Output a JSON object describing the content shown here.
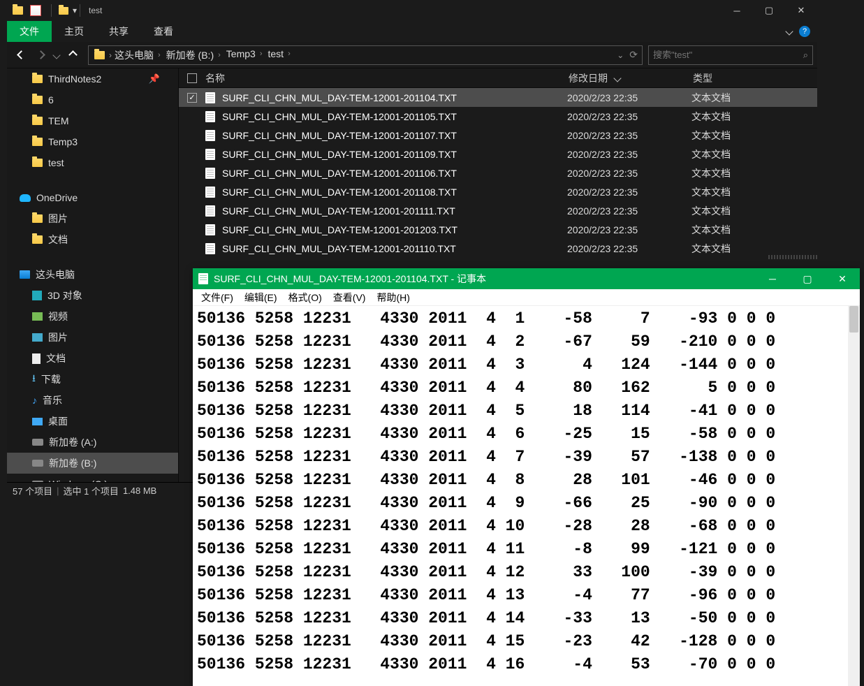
{
  "explorer": {
    "window_title": "test",
    "ribbon_tabs": [
      "文件",
      "主页",
      "共享",
      "查看"
    ],
    "breadcrumbs": [
      "这头电脑",
      "新加卷 (B:)",
      "Temp3",
      "test"
    ],
    "search_placeholder": "搜索\"test\"",
    "nav_pane": {
      "quick": [
        {
          "label": "ThirdNotes2",
          "pinned": true
        },
        {
          "label": "6"
        },
        {
          "label": "TEM"
        },
        {
          "label": "Temp3"
        },
        {
          "label": "test"
        }
      ],
      "onedrive_label": "OneDrive",
      "onedrive_children": [
        {
          "label": "图片"
        },
        {
          "label": "文档"
        }
      ],
      "thispc_label": "这头电脑",
      "thispc_children": [
        {
          "label": "3D 对象",
          "ic": "cube"
        },
        {
          "label": "视频",
          "ic": "film"
        },
        {
          "label": "图片",
          "ic": "pic"
        },
        {
          "label": "文档",
          "ic": "doc"
        },
        {
          "label": "下载",
          "ic": "down"
        },
        {
          "label": "音乐",
          "ic": "music"
        },
        {
          "label": "桌面",
          "ic": "desk"
        },
        {
          "label": "新加卷 (A:)",
          "ic": "drive"
        },
        {
          "label": "新加卷 (B:)",
          "ic": "drive",
          "selected": true
        },
        {
          "label": "Windows (C:)",
          "ic": "drive"
        }
      ]
    },
    "columns": {
      "name": "名称",
      "date": "修改日期",
      "type": "类型"
    },
    "files": [
      {
        "name": "SURF_CLI_CHN_MUL_DAY-TEM-12001-201104.TXT",
        "date": "2020/2/23 22:35",
        "type": "文本文档",
        "selected": true
      },
      {
        "name": "SURF_CLI_CHN_MUL_DAY-TEM-12001-201105.TXT",
        "date": "2020/2/23 22:35",
        "type": "文本文档"
      },
      {
        "name": "SURF_CLI_CHN_MUL_DAY-TEM-12001-201107.TXT",
        "date": "2020/2/23 22:35",
        "type": "文本文档"
      },
      {
        "name": "SURF_CLI_CHN_MUL_DAY-TEM-12001-201109.TXT",
        "date": "2020/2/23 22:35",
        "type": "文本文档"
      },
      {
        "name": "SURF_CLI_CHN_MUL_DAY-TEM-12001-201106.TXT",
        "date": "2020/2/23 22:35",
        "type": "文本文档"
      },
      {
        "name": "SURF_CLI_CHN_MUL_DAY-TEM-12001-201108.TXT",
        "date": "2020/2/23 22:35",
        "type": "文本文档"
      },
      {
        "name": "SURF_CLI_CHN_MUL_DAY-TEM-12001-201111.TXT",
        "date": "2020/2/23 22:35",
        "type": "文本文档"
      },
      {
        "name": "SURF_CLI_CHN_MUL_DAY-TEM-12001-201203.TXT",
        "date": "2020/2/23 22:35",
        "type": "文本文档"
      },
      {
        "name": "SURF_CLI_CHN_MUL_DAY-TEM-12001-201110.TXT",
        "date": "2020/2/23 22:35",
        "type": "文本文档"
      }
    ],
    "status": {
      "count": "57 个项目",
      "sel": "选中 1 个项目",
      "size": "1.48 MB"
    }
  },
  "notepad": {
    "title": "SURF_CLI_CHN_MUL_DAY-TEM-12001-201104.TXT - 记事本",
    "menu": [
      "文件(F)",
      "编辑(E)",
      "格式(O)",
      "查看(V)",
      "帮助(H)"
    ],
    "lines": [
      "50136 5258 12231   4330 2011  4  1    -58     7    -93 0 0 0",
      "50136 5258 12231   4330 2011  4  2    -67    59   -210 0 0 0",
      "50136 5258 12231   4330 2011  4  3      4   124   -144 0 0 0",
      "50136 5258 12231   4330 2011  4  4     80   162      5 0 0 0",
      "50136 5258 12231   4330 2011  4  5     18   114    -41 0 0 0",
      "50136 5258 12231   4330 2011  4  6    -25    15    -58 0 0 0",
      "50136 5258 12231   4330 2011  4  7    -39    57   -138 0 0 0",
      "50136 5258 12231   4330 2011  4  8     28   101    -46 0 0 0",
      "50136 5258 12231   4330 2011  4  9    -66    25    -90 0 0 0",
      "50136 5258 12231   4330 2011  4 10    -28    28    -68 0 0 0",
      "50136 5258 12231   4330 2011  4 11     -8    99   -121 0 0 0",
      "50136 5258 12231   4330 2011  4 12     33   100    -39 0 0 0",
      "50136 5258 12231   4330 2011  4 13     -4    77    -96 0 0 0",
      "50136 5258 12231   4330 2011  4 14    -33    13    -50 0 0 0",
      "50136 5258 12231   4330 2011  4 15    -23    42   -128 0 0 0",
      "50136 5258 12231   4330 2011  4 16     -4    53    -70 0 0 0"
    ]
  }
}
